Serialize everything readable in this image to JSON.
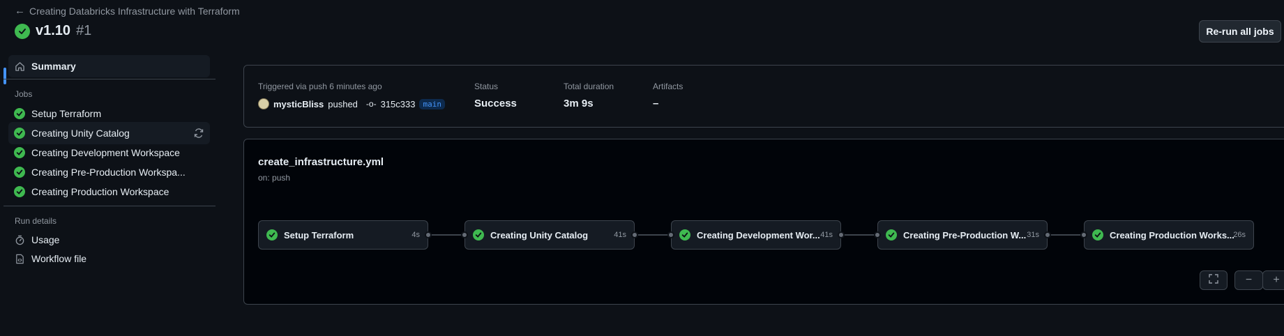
{
  "header": {
    "back_label": "Creating Databricks Infrastructure with Terraform",
    "title": "v1.10",
    "run_number": "#1",
    "rerun_label": "Re-run all jobs"
  },
  "sidebar": {
    "summary_label": "Summary",
    "jobs_heading": "Jobs",
    "jobs": [
      {
        "label": "Setup Terraform"
      },
      {
        "label": "Creating Unity Catalog"
      },
      {
        "label": "Creating Development Workspace"
      },
      {
        "label": "Creating Pre-Production Workspa..."
      },
      {
        "label": "Creating Production Workspace"
      }
    ],
    "run_details_heading": "Run details",
    "usage_label": "Usage",
    "workflow_file_label": "Workflow file"
  },
  "summary": {
    "trigger_text": "Triggered via push 6 minutes ago",
    "user": "mysticBliss",
    "action": "pushed",
    "commit": "315c333",
    "branch": "main",
    "status_label": "Status",
    "status_value": "Success",
    "duration_label": "Total duration",
    "duration_value": "3m 9s",
    "artifacts_label": "Artifacts",
    "artifacts_value": "–"
  },
  "workflow": {
    "file": "create_infrastructure.yml",
    "trigger": "on: push",
    "jobs": [
      {
        "name": "Setup Terraform",
        "time": "4s"
      },
      {
        "name": "Creating Unity Catalog",
        "time": "41s"
      },
      {
        "name": "Creating Development Wor...",
        "time": "41s"
      },
      {
        "name": "Creating Pre-Production W...",
        "time": "31s"
      },
      {
        "name": "Creating Production Works...",
        "time": "26s"
      }
    ],
    "zoom_out": "−",
    "zoom_in": "+"
  },
  "colors": {
    "success": "#3fb950",
    "accent": "#4493f8",
    "background": "#0d1117"
  },
  "icons": [
    "arrow-left-icon",
    "check-circle-icon",
    "home-icon",
    "sync-icon",
    "stopwatch-icon",
    "file-code-icon",
    "git-commit-icon",
    "fullscreen-icon"
  ]
}
